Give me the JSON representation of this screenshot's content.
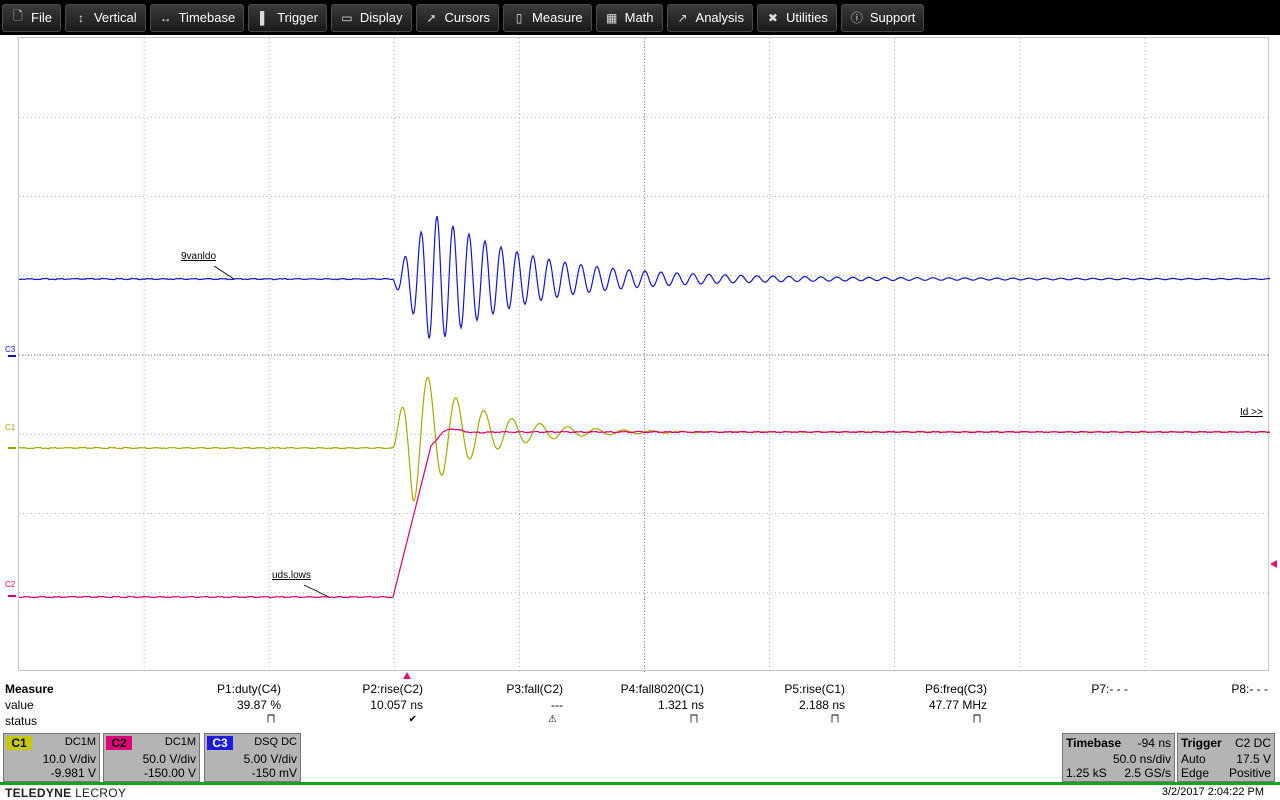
{
  "menu": [
    {
      "label": "File",
      "icon": "file-icon"
    },
    {
      "label": "Vertical",
      "icon": "vertical-arrows-icon"
    },
    {
      "label": "Timebase",
      "icon": "horizontal-arrows-icon"
    },
    {
      "label": "Trigger",
      "icon": "trigger-icon"
    },
    {
      "label": "Display",
      "icon": "display-icon"
    },
    {
      "label": "Cursors",
      "icon": "cursor-icon"
    },
    {
      "label": "Measure",
      "icon": "measure-icon"
    },
    {
      "label": "Math",
      "icon": "calculator-icon"
    },
    {
      "label": "Analysis",
      "icon": "analysis-icon"
    },
    {
      "label": "Utilities",
      "icon": "tools-icon"
    },
    {
      "label": "Support",
      "icon": "info-icon"
    }
  ],
  "colors": {
    "c1": "#a8a800",
    "c2": "#d8006c",
    "c3": "#1414c8",
    "grid": "#a0a0a0"
  },
  "screen": {
    "channel_markers": {
      "c1": "C1",
      "c2": "C2",
      "c3": "C3"
    },
    "trace_labels": {
      "c3": "9vanldo",
      "c2": "uds.lows",
      "c1": "Id >>"
    }
  },
  "measure": {
    "title": "Measure",
    "row_labels": [
      "value",
      "status"
    ],
    "columns": [
      {
        "name": "P1:duty(C4)",
        "value": "39.87 %",
        "status": "pulse"
      },
      {
        "name": "P2:rise(C2)",
        "value": "10.057 ns",
        "status": "check"
      },
      {
        "name": "P3:fall(C2)",
        "value": "---",
        "status": "warning"
      },
      {
        "name": "P4:fall8020(C1)",
        "value": "1.321 ns",
        "status": "pulse"
      },
      {
        "name": "P5:rise(C1)",
        "value": "2.188 ns",
        "status": "pulse"
      },
      {
        "name": "P6:freq(C3)",
        "value": "47.77 MHz",
        "status": "pulse"
      },
      {
        "name": "P7:- - -",
        "value": "",
        "status": ""
      },
      {
        "name": "P8:- - -",
        "value": "",
        "status": ""
      }
    ]
  },
  "channels": [
    {
      "tag": "C1",
      "coupling": "DC1M",
      "scale": "10.0 V/div",
      "offset": "-9.981 V",
      "color": "#c8c800"
    },
    {
      "tag": "C2",
      "coupling": "DC1M",
      "scale": "50.0 V/div",
      "offset": "-150.00 V",
      "color": "#e0007a"
    },
    {
      "tag": "C3",
      "coupling": "DSQ  DC",
      "scale": "5.00 V/div",
      "offset": "-150 mV",
      "color": "#1a1ae0"
    }
  ],
  "timebase": {
    "title": "Timebase",
    "delay": "-94 ns",
    "scale": "50.0 ns/div",
    "samples": "1.25 kS",
    "rate": "2.5 GS/s"
  },
  "trigger": {
    "title": "Trigger",
    "source": "C2  DC",
    "mode": "Auto",
    "level": "17.5 V",
    "type": "Edge",
    "slope": "Positive"
  },
  "footer": {
    "brand": "TELEDYNE",
    "brand2": "LECROY",
    "datetime": "3/2/2017 2:04:22 PM"
  }
}
